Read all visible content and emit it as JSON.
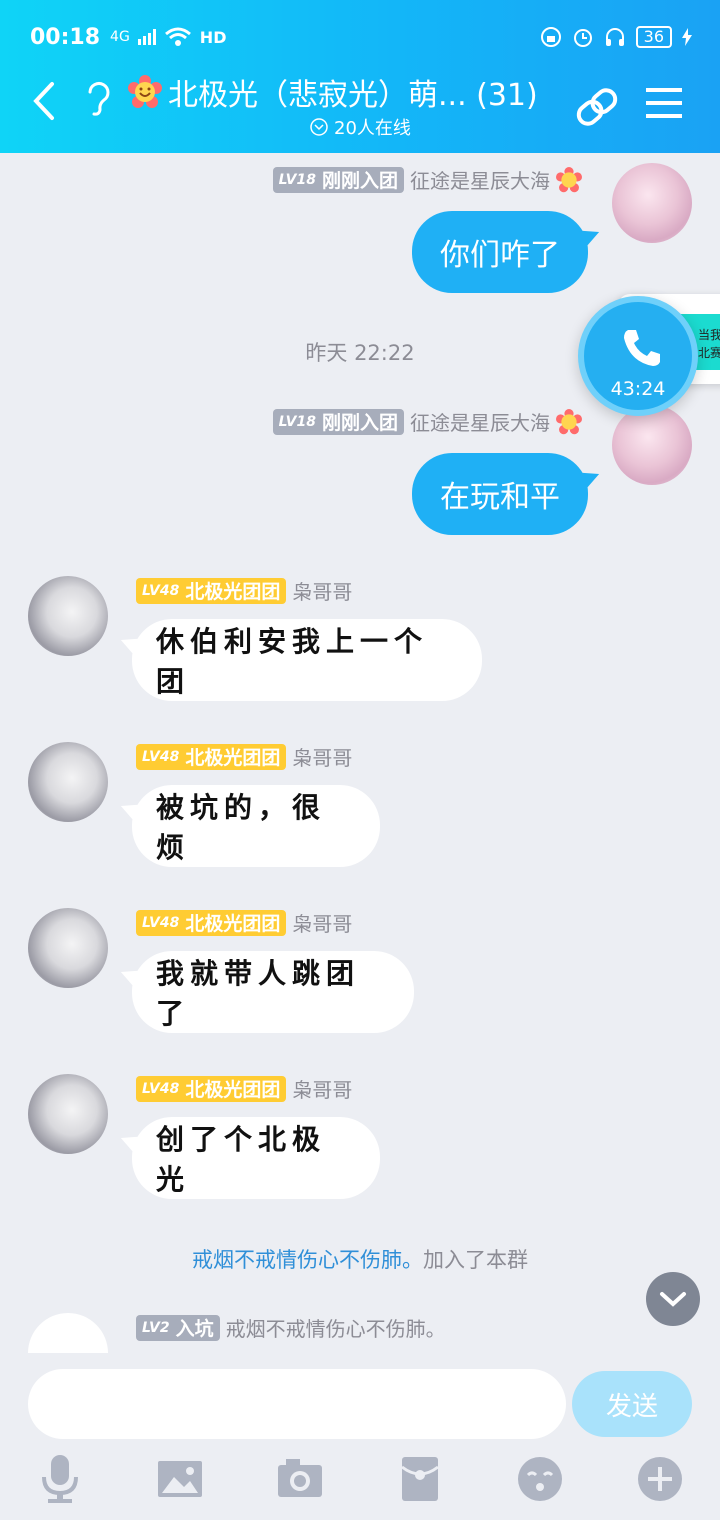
{
  "status": {
    "time": "00:18",
    "network": "4G",
    "hd": "HD",
    "battery": "36"
  },
  "header": {
    "title": "北极光（悲寂光）萌... (31)",
    "online": "20人在线"
  },
  "messages": {
    "m1": {
      "level": "LV18",
      "rank": "刚刚入团",
      "name": "征途是星辰大海",
      "text": "你们咋了"
    },
    "timestamp": "昨天 22:22",
    "m2": {
      "level": "LV18",
      "rank": "刚刚入团",
      "name": "征途是星辰大海",
      "text": "在玩和平"
    },
    "m3": {
      "level": "LV48",
      "rank": "北极光团团",
      "name": "枭哥哥",
      "text": "休伯利安我上一个团"
    },
    "m4": {
      "level": "LV48",
      "rank": "北极光团团",
      "name": "枭哥哥",
      "text": "被坑的，很烦"
    },
    "m5": {
      "level": "LV48",
      "rank": "北极光团团",
      "name": "枭哥哥",
      "text": "我就带人跳团了"
    },
    "m6": {
      "level": "LV48",
      "rank": "北极光团团",
      "name": "枭哥哥",
      "text": "创了个北极光"
    },
    "system": {
      "name": "戒烟不戒情伤心不伤肺。",
      "action": "加入了本群"
    },
    "m7": {
      "level": "LV2",
      "rank": "入坑",
      "name": "戒烟不戒情伤心不伤肺。"
    }
  },
  "call": {
    "duration": "43:24",
    "card_line1": "当我",
    "card_line2": "北赛"
  },
  "input": {
    "placeholder": "",
    "send_label": "发送"
  },
  "toolbar": {
    "icons": [
      "microphone-icon",
      "image-icon",
      "camera-icon",
      "red-packet-icon",
      "emoji-icon",
      "plus-icon"
    ]
  },
  "colors": {
    "header_start": "#0fd4f7",
    "header_end": "#1aa2f4",
    "bubble_out": "#1fb0f5",
    "badge_gold": "#ffcc33",
    "badge_grey": "#a7adbb"
  }
}
